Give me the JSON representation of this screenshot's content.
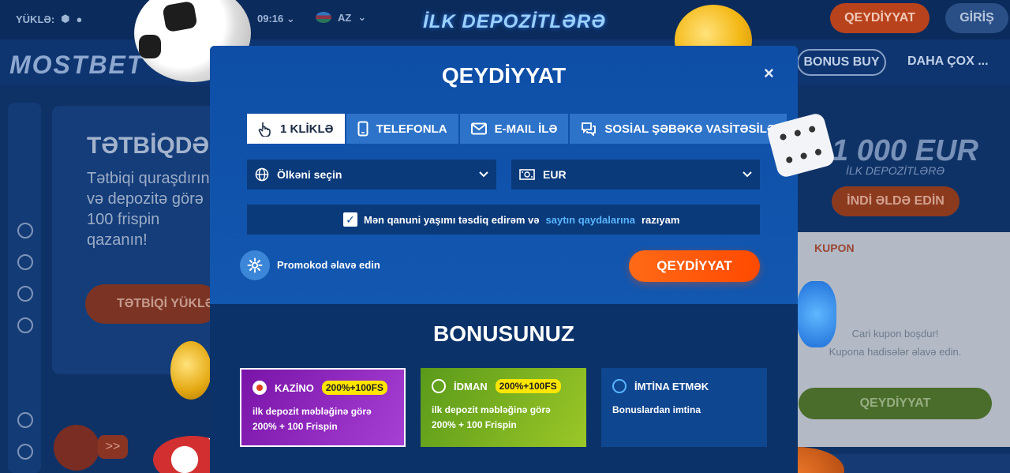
{
  "header": {
    "download_label": "YÜKLƏ:",
    "time": "09:16",
    "language": "AZ",
    "promo_banner_title": "İLK DEPOZİTLƏRƏ",
    "register_label": "QEYDİYYAT",
    "login_label": "GİRİŞ"
  },
  "nav": {
    "logo_text": "MOSTBET",
    "bonus_buy_label": "BONUS BUY",
    "more_label": "DAHA ÇOX ..."
  },
  "banner": {
    "title": "TƏTBİQDƏ",
    "text": "Tətbiqi quraşdırın və depozitə görə 100 frispin qazanın!",
    "button_label": "TƏTBİQİ YÜKLƏ"
  },
  "right_promo": {
    "amount": "1 000 EUR",
    "subtitle": "İLK DEPOZİTLƏRƏ",
    "button_label": "İNDİ ƏLDƏ EDİN"
  },
  "coupon": {
    "header_label": "KUPON",
    "empty_line1": "Cari kupon boşdur!",
    "empty_line2": "Kupona hadisələr əlavə edin.",
    "button_label": "QEYDİYYAT"
  },
  "gift": {
    "arrow_label": ">>"
  },
  "modal": {
    "title": "QEYDİYYAT",
    "close_label": "×",
    "tabs": [
      {
        "label": "1 KLİKLƏ",
        "icon": "hand-pointer-icon",
        "active": true
      },
      {
        "label": "TELEFONLA",
        "icon": "phone-icon",
        "active": false
      },
      {
        "label": "E-MAIL İLƏ",
        "icon": "envelope-icon",
        "active": false
      },
      {
        "label": "SOSİAL ŞƏBƏKƏ VASİTƏSİLƏ",
        "icon": "chat-icon",
        "active": false
      }
    ],
    "country_select": {
      "value": "Ölkəni seçin",
      "icon": "globe-icon"
    },
    "currency_select": {
      "value": "EUR",
      "icon": "money-icon"
    },
    "agree": {
      "checked": true,
      "text_before": "Mən qanuni yaşımı təsdiq edirəm və",
      "link_text": "saytın qaydalarına",
      "text_after": "razıyam"
    },
    "promo_label": "Promokod əlavə edin",
    "register_button": "QEYDİYYAT",
    "bonus_title": "BONUSUNUZ",
    "bonus_options": [
      {
        "name": "KAZİNO",
        "badge": "200%+100FS",
        "line1": "ilk depozit məbləğinə görə",
        "line2": "200% + 100 Frispin",
        "selected": true
      },
      {
        "name": "İDMAN",
        "badge": "200%+100FS",
        "line1": "ilk depozit məbləğinə görə",
        "line2": "200% + 100 Frispin",
        "selected": false
      },
      {
        "name": "İMTİNA ETMƏK",
        "badge": "",
        "line1": "Bonuslardan imtina",
        "line2": "",
        "selected": false
      }
    ]
  },
  "colors": {
    "modal_bg": "#0d4a9e",
    "accent_orange": "#ff5a0a",
    "tab_blue": "#2d73c9",
    "link_blue": "#58b5ff",
    "casino_purple": "#8d24bd",
    "sport_green": "#7fb521",
    "badge_yellow": "#ffe600"
  }
}
